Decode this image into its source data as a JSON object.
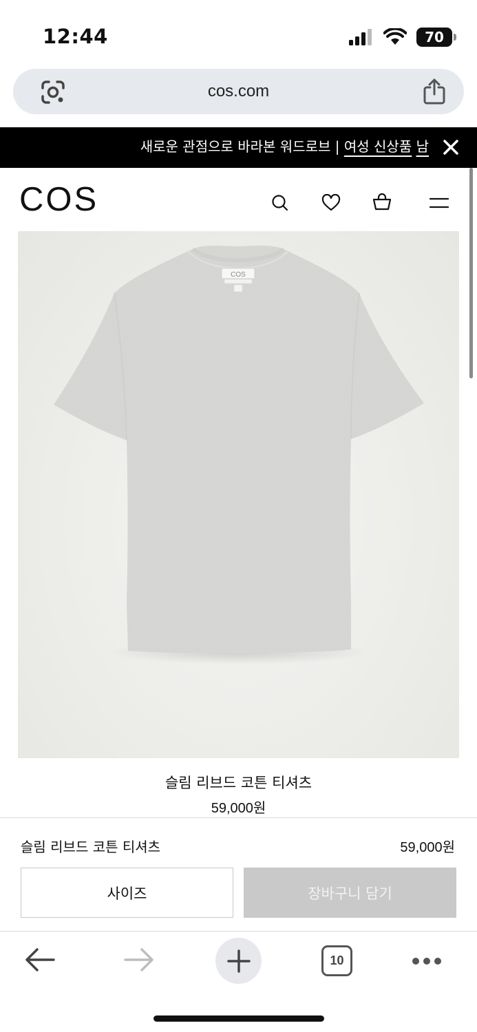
{
  "status_bar": {
    "time": "12:44",
    "battery": "70",
    "icons": [
      "cellular-signal-icon",
      "wifi-icon",
      "battery-icon"
    ]
  },
  "browser": {
    "url": "cos.com",
    "lens_icon": "google-lens-icon",
    "share_icon": "share-icon"
  },
  "banner": {
    "text": "새로운 관점으로 바라본 워드로브 | ",
    "link_women": "여성 신상품",
    "link_men": "남",
    "close_icon": "close-icon"
  },
  "header": {
    "logo": "COS",
    "icons": [
      "search-icon",
      "heart-icon",
      "shopping-bag-icon",
      "menu-icon"
    ]
  },
  "product": {
    "image_label": "COS",
    "name": "슬림 리브드 코튼 티셔츠",
    "price": "59,000원"
  },
  "buy_bar": {
    "name": "슬림 리브드 코튼 티셔츠",
    "price": "59,000원",
    "size_label": "사이즈",
    "cart_label": "장바구니 담기"
  },
  "toolbar": {
    "tab_count": "10",
    "icons": [
      "back-arrow-icon",
      "forward-arrow-icon",
      "plus-icon",
      "tabs-icon",
      "more-icon"
    ]
  },
  "colors": {
    "banner_bg": "#000000",
    "url_bar_bg": "#e6e9ee",
    "cart_button_bg": "#c9c9c9",
    "product_bg": "#ecece9",
    "tshirt": "#d7d7d5"
  }
}
